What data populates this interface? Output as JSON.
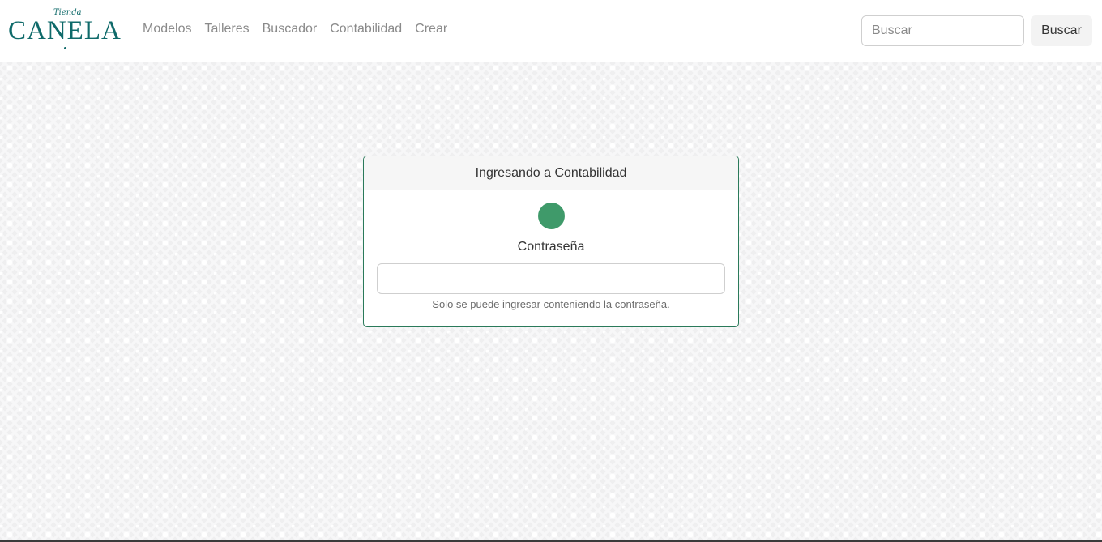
{
  "brand": {
    "small": "Tienda",
    "big": "CANELA"
  },
  "nav": {
    "links": [
      "Modelos",
      "Talleres",
      "Buscador",
      "Contabilidad",
      "Crear"
    ]
  },
  "search": {
    "placeholder": "Buscar",
    "button_label": "Buscar"
  },
  "login_card": {
    "title": "Ingresando a Contabilidad",
    "password_label": "Contraseña",
    "password_value": "",
    "help_text": "Solo se puede ingresar conteniendo la contraseña."
  },
  "colors": {
    "brand": "#0f6a6a",
    "status_dot": "#3f9a6a",
    "card_border": "#2a7a5a"
  }
}
